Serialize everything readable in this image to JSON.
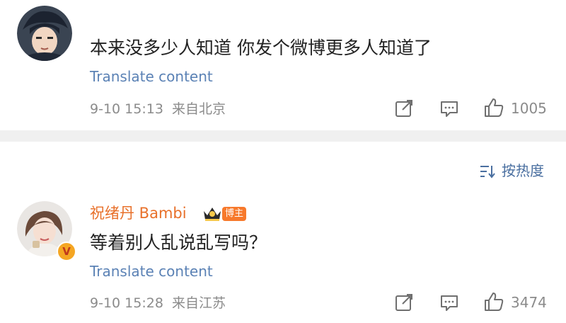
{
  "comments": [
    {
      "text": "本来没多少人知道 你发个微博更多人知道了",
      "translate_label": "Translate content",
      "time": "9-10 15:13",
      "location": "来自北京",
      "likes": "1005"
    },
    {
      "username": "祝绪丹 Bambi",
      "badge": "博主",
      "verified_mark": "V",
      "text": "等着别人乱说乱写吗？",
      "translate_label": "Translate content",
      "time": "9-10 15:28",
      "location": "来自江苏",
      "likes": "3474"
    }
  ],
  "sort": {
    "label": "按热度"
  },
  "icons": [
    "share-icon",
    "comment-icon",
    "like-icon",
    "sort-icon",
    "crown-icon"
  ],
  "colors": {
    "link": "#5b82b5",
    "username": "#e8702a",
    "meta": "#8b8b8b",
    "divider": "#f0f0f0"
  }
}
